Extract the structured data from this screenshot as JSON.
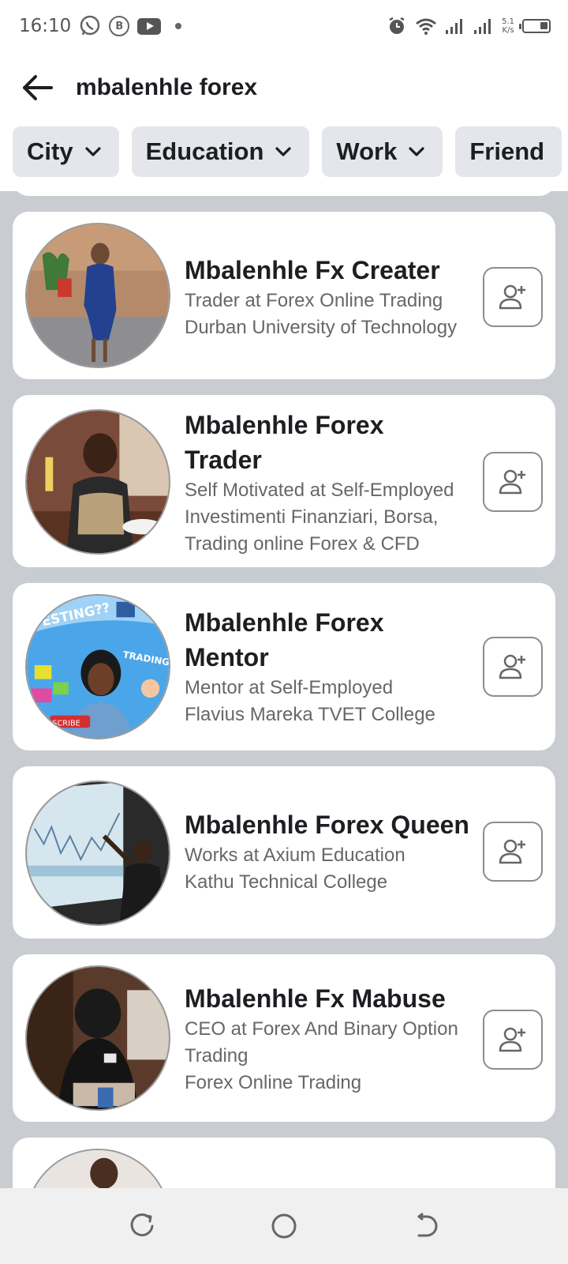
{
  "status_bar": {
    "time": "16:10",
    "net_speed_value": "5.1",
    "net_speed_unit": "K/s"
  },
  "search": {
    "query": "mbalenhle forex"
  },
  "filters": [
    {
      "label": "City"
    },
    {
      "label": "Education"
    },
    {
      "label": "Work"
    },
    {
      "label": "Friend"
    }
  ],
  "results": [
    {
      "name_lines": [
        "Mbalenhle Fx Creater"
      ],
      "details": [
        "Trader at Forex Online Trading",
        "Durban University of Technology"
      ]
    },
    {
      "name_lines": [
        "Mbalenhle Forex",
        "Trader"
      ],
      "details": [
        "Self Motivated at Self-Employed",
        "Investimenti Finanziari, Borsa,",
        "Trading online Forex & CFD"
      ]
    },
    {
      "name_lines": [
        "Mbalenhle Forex",
        "Mentor"
      ],
      "details": [
        "Mentor at Self-Employed",
        "Flavius Mareka TVET College"
      ]
    },
    {
      "name_lines": [
        "Mbalenhle Forex Queen"
      ],
      "details": [
        "Works at Axium Education",
        "Kathu Technical College"
      ]
    },
    {
      "name_lines": [
        "Mbalenhle Fx Mabuse"
      ],
      "details": [
        "CEO at Forex And Binary Option",
        "Trading",
        "Forex Online Trading"
      ]
    }
  ],
  "avatar_texts": {
    "mentor_investing": "VESTING??",
    "mentor_trading": "TRADING",
    "mentor_subscribe": "SCRIBE"
  },
  "colors": {
    "chip_bg": "#e4e6eb",
    "feed_bg": "#c9ccd1",
    "text_primary": "#1c1e21",
    "text_secondary": "#65676b"
  }
}
